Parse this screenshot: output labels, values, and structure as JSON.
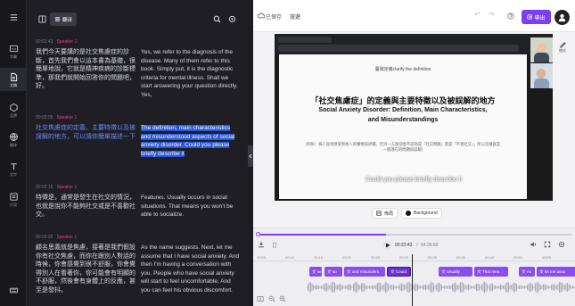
{
  "rail": {
    "items": [
      {
        "icon": "captions-icon",
        "label": "字幕"
      },
      {
        "icon": "document-icon",
        "label": "文稿"
      },
      {
        "icon": "brand-icon",
        "label": "品牌"
      },
      {
        "icon": "translate-icon",
        "label": "翻译"
      },
      {
        "icon": "text-icon",
        "label": "文字"
      },
      {
        "icon": "clip-icon",
        "label": "片段"
      }
    ]
  },
  "transcript": {
    "tab_label": "翻译",
    "segments": [
      {
        "time": "00:01:43",
        "speaker": "Speaker 1",
        "original": "我們今天要講的是社交焦慮症的診斷，首先我們會以這本書為基礎，很簡單地說，它就是精神疾病的診斷標準，那我們就開始回答你的問題吧，好。",
        "translation": "Yes, we refer to the diagnosis of the disease. Many of them refer to this book. Simply put, it is the diagnostic criteria for mental illness. Shall we start answering your question directly. Yes,"
      },
      {
        "time": "00:02:05",
        "speaker": "Speaker 1",
        "original": "社交焦慮症的定義、主要特徵以及被誤解的地方，可以請你簡單描述一下",
        "translation": "The definition, main characteristics and misunderstood aspects of social anxiety disorder. Could you please briefly describe it"
      },
      {
        "time": "00:02:16",
        "speaker": "Speaker 1",
        "original": "特徵是，通常是發生在社交的情況，也就是說你不能夠社交或是不喜歡社交。",
        "translation": "Features. Usually occurs in social situations. That means you won't be able to socialize."
      },
      {
        "time": "00:02:29",
        "speaker": "Speaker 1",
        "original": "顧名思義就是焦慮，接著是我們假設你有社交焦慮，而你在跟別人對話的時候，你會感覺到很不舒服，你會覺得別人在看著你，你可能會有明顯的不舒服，然後會有身體上的反應，甚至是發抖。",
        "translation": "As the name suggests. Next, let me assume that I have social anxiety. And then I'm having a conversation with you. People who have social anxiety will start to feel uncomfortable. And you can feel his obvious discomfort."
      }
    ]
  },
  "topbar": {
    "saved": "已保存",
    "project": "旅遊",
    "export_label": "導出",
    "undo": "↶",
    "redo": "↷"
  },
  "preview": {
    "slide_heading_small": "臺灣定義clarify the definition",
    "slide_title_zh": "「社交焦慮症」的定義與主要特徵以及被誤解的地方",
    "slide_title_en1": "Social Anxiety Disorder: Definition, Main Characteristics,",
    "slide_title_en2": "and Misunderstandings",
    "slide_note": "(例如：病人容易感受到他人的審視與評價，但另一方面卻並不認為是「社交問題」而是「不善社交」，所以這樣就是一個潛在的問題與誤解)",
    "subtitle": "Could you please briefly describe it",
    "style_label": "樣式"
  },
  "chips": {
    "layout": "佈局",
    "background": "Background"
  },
  "timeline": {
    "progress": 0.41,
    "current": "00:22:43",
    "total": "54:36.60",
    "ruler": [
      "00:05",
      "00:10",
      "00:15",
      "00:20",
      "00:25",
      "00:30",
      "00:35",
      "00:40",
      "00:45",
      "00:50",
      "00:55"
    ],
    "clips": [
      {
        "label": "文 we"
      },
      {
        "label": "文 so"
      },
      {
        "label": "文 and misunders"
      },
      {
        "label": "文 Could"
      },
      {
        "label": "文 Usually"
      },
      {
        "label": "文 That mea"
      },
      {
        "label": "文 As"
      },
      {
        "label": "文 let me assu"
      }
    ]
  }
}
